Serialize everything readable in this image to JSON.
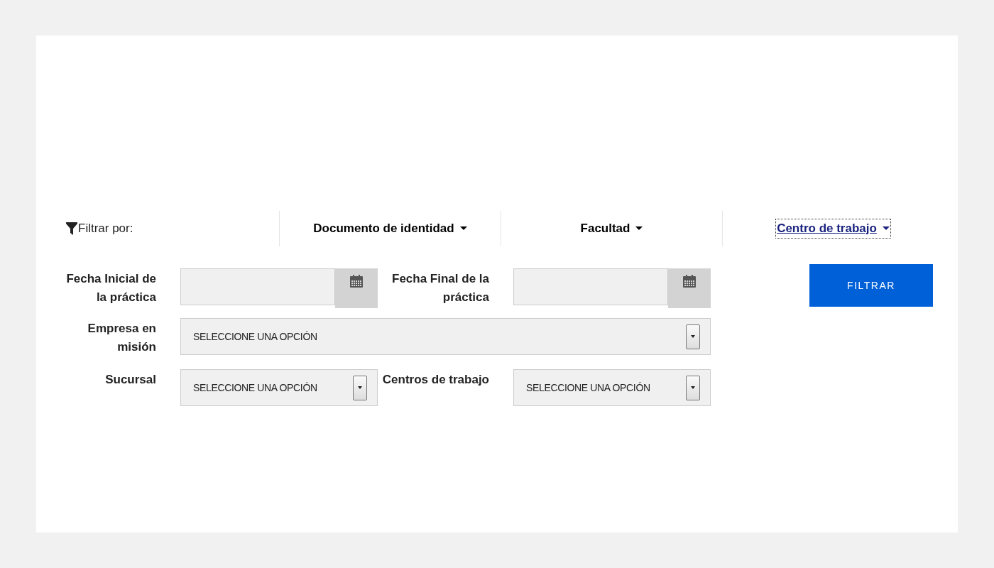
{
  "filter_bar": {
    "label": "Filtrar por:",
    "tabs": [
      {
        "label": "Documento de identidad",
        "selected": false
      },
      {
        "label": "Facultad",
        "selected": false
      },
      {
        "label": "Centro de trabajo",
        "selected": true
      }
    ]
  },
  "form": {
    "date_start": {
      "label": "Fecha Inicial de la práctica"
    },
    "date_end": {
      "label": "Fecha Final de la práctica"
    },
    "company": {
      "label": "Empresa en misión",
      "value": "SELECCIONE UNA OPCIÓN"
    },
    "branch": {
      "label": "Sucursal",
      "value": "SELECCIONE UNA OPCIÓN"
    },
    "work_centers": {
      "label": "Centros de trabajo",
      "value": "SELECCIONE UNA OPCIÓN"
    }
  },
  "filter_button": "FILTRAR"
}
